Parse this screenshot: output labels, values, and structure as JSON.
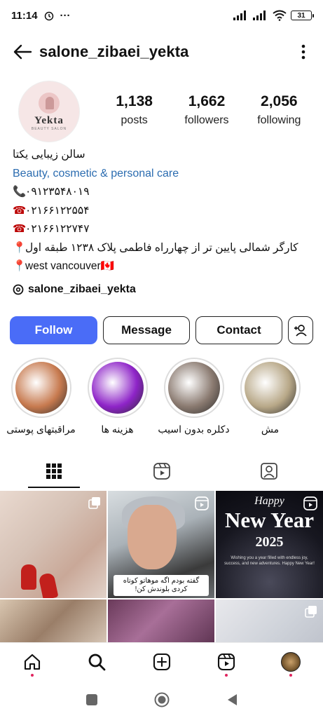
{
  "status_bar": {
    "time": "11:14",
    "dots": "···",
    "battery": "31"
  },
  "header": {
    "username": "salone_zibaei_yekta"
  },
  "profile": {
    "avatar_brand": "Yekta",
    "avatar_sub": "BEAUTY SALON",
    "stats": [
      {
        "value": "1,138",
        "label": "posts"
      },
      {
        "value": "1,662",
        "label": "followers"
      },
      {
        "value": "2,056",
        "label": "following"
      }
    ],
    "bio": {
      "name": "سالن زیبایی یکتا",
      "category": "Beauty, cosmetic & personal care",
      "phone_mobile": "۰۹۱۲۳۵۴۸۰۱۹",
      "phone_1": "۰۲۱۶۶۱۲۲۵۵۴",
      "phone_2": "۰۲۱۶۶۱۲۲۷۴۷",
      "address": "کارگر شمالی پایین تر از چهارراه فاطمی پلاک ۱۲۳۸ طبقه اول",
      "location": "west vancouver🇨🇦",
      "threads_handle": "salone_zibaei_yekta"
    }
  },
  "actions": {
    "follow": "Follow",
    "message": "Message",
    "contact": "Contact"
  },
  "highlights": [
    {
      "label": "مراقبتهای پوستی",
      "color": "#c77a4f"
    },
    {
      "label": "هزینه ها",
      "color": "#8e24c8"
    },
    {
      "label": "دکلره بدون اسیب",
      "color": "#8a7a70"
    },
    {
      "label": "مش",
      "color": "#b8a888"
    }
  ],
  "posts": {
    "caption_2": "گفته بودم اگه موهاتو کوتاه کردی بلوندش کن!",
    "newyear_happy": "Happy",
    "newyear_title": "New Year",
    "newyear_year": "2025",
    "newyear_msg": "Wishing you a year filled with endless joy, success, and new adventures. Happy New Year!"
  },
  "icons": [
    "back-arrow-icon",
    "more-vertical-icon",
    "threads-icon",
    "add-user-icon",
    "grid-icon",
    "reels-icon",
    "tagged-icon",
    "home-icon",
    "search-icon",
    "create-icon",
    "reels-nav-icon",
    "profile-avatar"
  ],
  "colors": {
    "accent": "#4a6cf7",
    "link": "#2b6cb0",
    "notification": "#e0245e"
  }
}
